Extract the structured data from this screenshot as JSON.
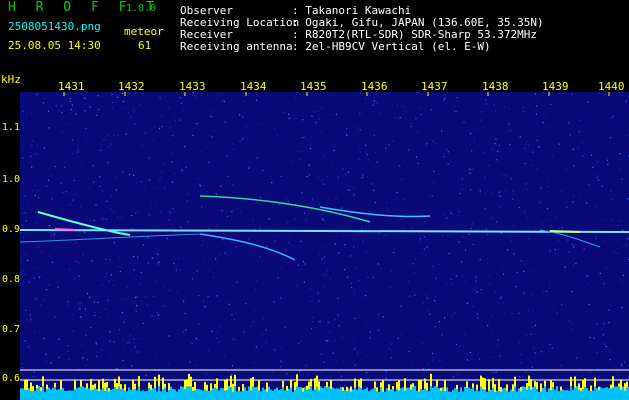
{
  "app": {
    "logo": "H R O F F T",
    "version": "1.0.0"
  },
  "file": {
    "name": "2508051430.png",
    "datetime": "25.08.05 14:30"
  },
  "meteor": {
    "label": "meteor",
    "count": "61"
  },
  "station": [
    {
      "label": "Observer",
      "value": ": Takanori Kawachi"
    },
    {
      "label": "Receiving Location",
      "value": ": Ogaki, Gifu, JAPAN (136.60E, 35.35N)"
    },
    {
      "label": "Receiver",
      "value": ": R820T2(RTL-SDR) SDR-Sharp 53.372MHz"
    },
    {
      "label": "Receiving antenna",
      "value": ": 2el-HB9CV Vertical (el. E-W)"
    }
  ],
  "axis": {
    "unit": "kHz",
    "time_ticks": [
      "1431",
      "1432",
      "1433",
      "1434",
      "1435",
      "1436",
      "1437",
      "1438",
      "1439",
      "1440"
    ],
    "freq_ticks": [
      "1.1",
      "1.0",
      "0.9",
      "0.8",
      "0.7",
      "0.6"
    ]
  },
  "colors": {
    "background": "#000000",
    "plot_bg": "#0a0a78",
    "label": "#ffff00",
    "logo": "#00d000"
  }
}
